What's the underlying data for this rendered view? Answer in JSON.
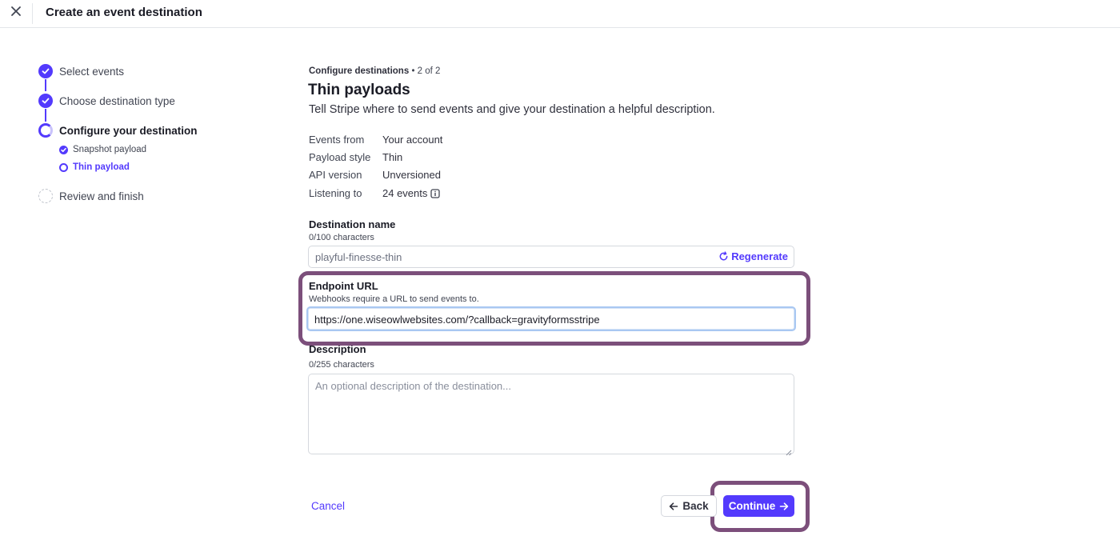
{
  "header": {
    "title": "Create an event destination",
    "close_icon": "close-icon"
  },
  "stepper": {
    "steps": [
      {
        "label": "Select events",
        "state": "done"
      },
      {
        "label": "Choose destination type",
        "state": "done"
      },
      {
        "label": "Configure your destination",
        "state": "current"
      },
      {
        "label": "Review and finish",
        "state": "pending"
      }
    ],
    "substeps": [
      {
        "label": "Snapshot payload",
        "state": "done"
      },
      {
        "label": "Thin payload",
        "state": "current"
      }
    ]
  },
  "main": {
    "breadcrumb": {
      "section": "Configure destinations",
      "separator": "•",
      "progress": "2 of 2"
    },
    "title": "Thin payloads",
    "subtitle": "Tell Stripe where to send events and give your destination a helpful description.",
    "info": [
      {
        "key": "Events from",
        "value": "Your account"
      },
      {
        "key": "Payload style",
        "value": "Thin"
      },
      {
        "key": "API version",
        "value": "Unversioned"
      },
      {
        "key": "Listening to",
        "value": "24 events"
      }
    ],
    "destination_name": {
      "label": "Destination name",
      "help": "0/100 characters",
      "value": "playful-finesse-thin",
      "regenerate_label": "Regenerate"
    },
    "endpoint_url": {
      "label": "Endpoint URL",
      "help": "Webhooks require a URL to send events to.",
      "value": "https://one.wiseowlwebsites.com/?callback=gravityformsstripe"
    },
    "description": {
      "label": "Description",
      "help": "0/255 characters",
      "placeholder": "An optional description of the destination..."
    }
  },
  "footer": {
    "cancel_label": "Cancel",
    "back_label": "Back",
    "continue_label": "Continue"
  },
  "colors": {
    "accent": "#533afd",
    "highlight": "#7c4f7b"
  }
}
